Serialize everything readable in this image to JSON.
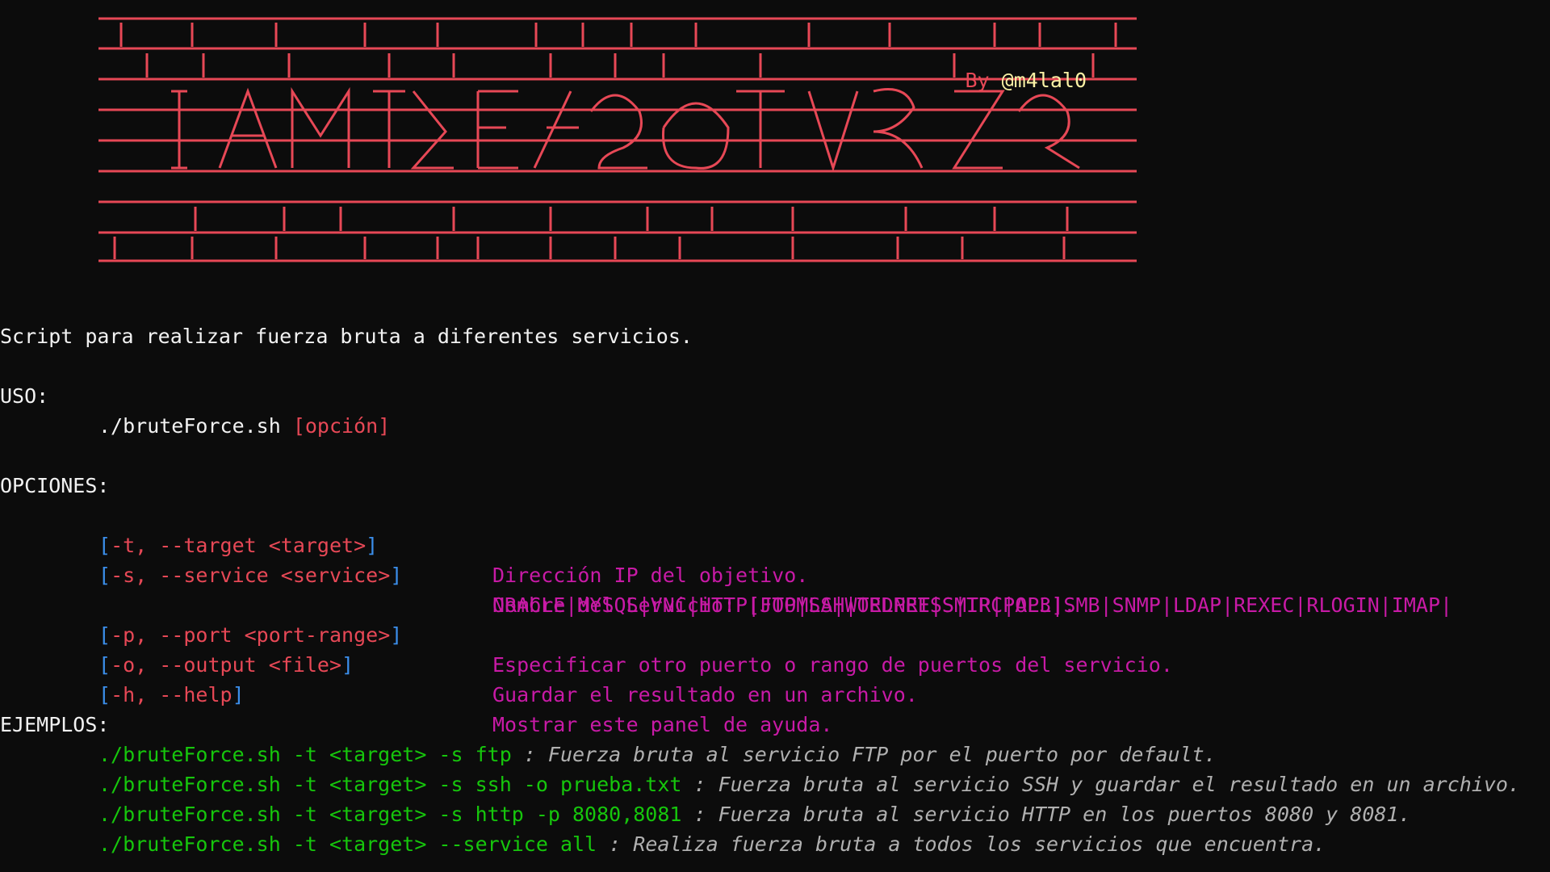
{
  "banner": {
    "credit_prefix": "By ",
    "credit_handle": "@m4lal0",
    "art_color": "#e74856"
  },
  "description": "Script para realizar fuerza bruta a diferentes servicios.",
  "usage": {
    "heading": "USO:",
    "command": "./bruteForce.sh ",
    "argument": "[opción]"
  },
  "options": {
    "heading": "OPCIONES:",
    "items": [
      {
        "flag": "[-t, --target <target>]",
        "desc": "Dirección IP del objetivo."
      },
      {
        "flag": "[-s, --service <service>]",
        "desc": "Nombre del Servicio: [FTP|SSH|TELNET|SMTP|POP3|SMB|SNMP|LDAP|REXEC|RLOGIN|IMAP|",
        "desc2": "ORACLE|MYSQL|VNC|HTTP|JOOMLA|WORDPRESS|IRC|ALL]."
      },
      {
        "flag": "[-p, --port <port-range>]",
        "desc": "Especificar otro puerto o rango de puertos del servicio."
      },
      {
        "flag": "[-o, --output <file>]",
        "desc": "Guardar el resultado en un archivo."
      },
      {
        "flag": "[-h, --help]",
        "desc": "Mostrar este panel de ayuda."
      }
    ]
  },
  "examples": {
    "heading": "EJEMPLOS:",
    "items": [
      {
        "cmd": "./bruteForce.sh -t <target> -s ftp",
        "note": " : Fuerza bruta al servicio FTP por el puerto por default."
      },
      {
        "cmd": "./bruteForce.sh -t <target> -s ssh -o prueba.txt",
        "note": " : Fuerza bruta al servicio SSH y guardar el resultado en un archivo."
      },
      {
        "cmd": "./bruteForce.sh -t <target> -s http -p 8080,8081",
        "note": " : Fuerza bruta al servicio HTTP en los puertos 8080 y 8081."
      },
      {
        "cmd": "./bruteForce.sh -t <target> --service all",
        "note": " : Realiza fuerza bruta a todos los servicios que encuentra."
      }
    ]
  },
  "colors": {
    "background": "#0c0c0c",
    "red": "#e74856",
    "blue": "#3b8eea",
    "magenta": "#c81aa6",
    "green": "#16c60c",
    "yellow": "#f9f1a5"
  }
}
